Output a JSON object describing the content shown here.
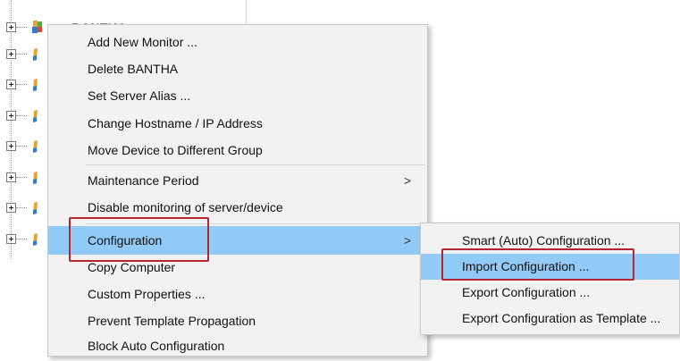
{
  "tree": {
    "first_node_label": "BANTHA",
    "row_count": 8
  },
  "context_menu": {
    "items": [
      {
        "label": "Add New Monitor ..."
      },
      {
        "label": "Delete BANTHA"
      },
      {
        "label": "Set Server Alias ..."
      },
      {
        "label": "Change Hostname / IP Address"
      },
      {
        "label": "Move Device to Different Group"
      },
      {
        "label": "Maintenance Period",
        "submenu_arrow": ">"
      },
      {
        "label": "Disable monitoring of server/device"
      },
      {
        "label": "Configuration",
        "submenu_arrow": ">",
        "highlighted": true
      },
      {
        "label": "Copy Computer"
      },
      {
        "label": "Custom Properties ..."
      },
      {
        "label": "Prevent Template Propagation"
      },
      {
        "label": "Block Auto Configuration"
      }
    ]
  },
  "configuration_submenu": {
    "items": [
      {
        "label": "Smart (Auto) Configuration ..."
      },
      {
        "label": "Import Configuration ...",
        "highlighted": true
      },
      {
        "label": "Export Configuration ..."
      },
      {
        "label": "Export Configuration as Template ..."
      }
    ]
  },
  "colors": {
    "highlight": "#91c9f7",
    "menu_background": "#f2f2f2",
    "annotation_box": "#b3262e"
  },
  "icons": {
    "tree_node": "monitor-server-icon",
    "expander": "plus-expander-icon",
    "submenu": "chevron-right-icon"
  }
}
